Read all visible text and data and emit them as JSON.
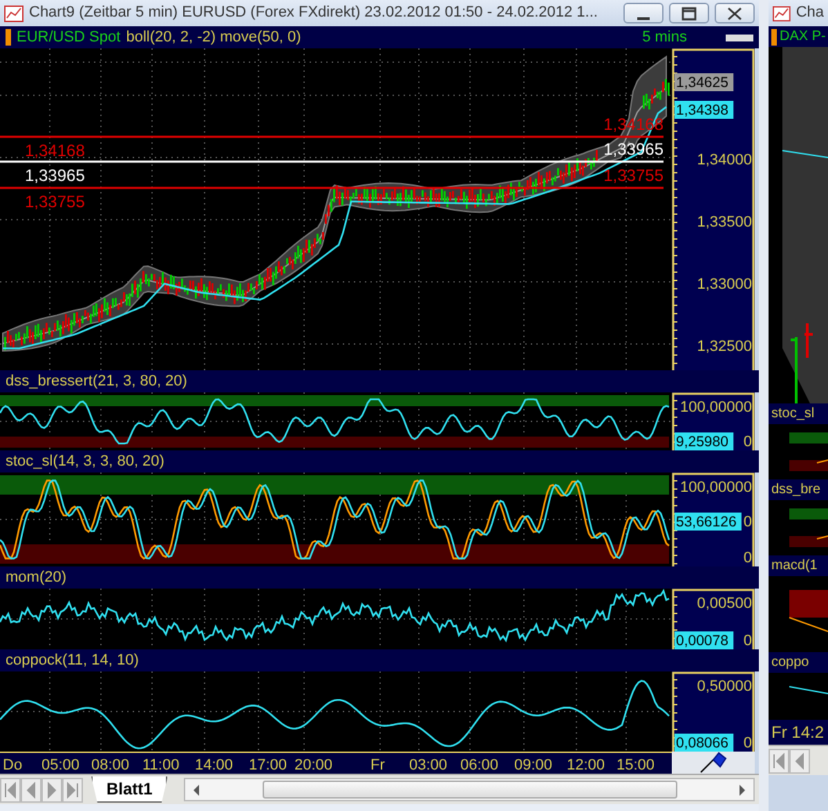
{
  "window": {
    "title": "Chart9 (Zeitbar 5 min)  EURUSD (Forex FXdirekt) 23.02.2012 01:50 - 24.02.2012 1..."
  },
  "chart_header": {
    "instrument": "EUR/USD Spot",
    "indicators": "boll(20, 2, -2) move(50, 0)",
    "interval": "5 mins"
  },
  "price_panel": {
    "axis_labels": [
      "1,34000",
      "1,33500",
      "1,33000",
      "1,32500"
    ],
    "last_price": "1,34625",
    "average": "1,34398",
    "levels": [
      {
        "left_label": "1,34168",
        "right_label": "1,34168",
        "color": "#e00000"
      },
      {
        "left_label": "1,33965",
        "right_label": "1,33965",
        "color": "#ffffff"
      },
      {
        "left_label": "1,33755",
        "right_label": "1,33755",
        "color": "#e00000"
      }
    ]
  },
  "panels": [
    {
      "title": "dss_bressert(21, 3, 80, 20)",
      "kind": "band",
      "top_label": "100,00000",
      "value": "9,25980",
      "zero_label": "0"
    },
    {
      "title": "stoc_sl(14, 3, 3, 80, 20)",
      "kind": "double_band",
      "top_label": "100,00000",
      "value": "53,66126",
      "zero_label": "0",
      "bottom_label": "0"
    },
    {
      "title": "mom(20)",
      "kind": "line",
      "top_label": "0,00500",
      "value": "0,00078",
      "zero_label": "0"
    },
    {
      "title": "coppock(11, 14, 10)",
      "kind": "smooth_line",
      "top_label": "0,50000",
      "value": "0,08066",
      "zero_label": "0"
    }
  ],
  "time_axis": [
    "Do",
    "05:00",
    "08:00",
    "11:00",
    "14:00",
    "17:00",
    "20:00",
    "Fr",
    "03:00",
    "06:00",
    "09:00",
    "12:00",
    "15:00"
  ],
  "sheet_tabs": [
    {
      "label": "Blatt1",
      "selected": true
    }
  ],
  "second_window": {
    "title": "Cha",
    "header": "DAX P-",
    "panels": [
      "stoc_sl",
      "dss_bre",
      "macd(1",
      "coppo"
    ],
    "time": "Fr 14:2"
  }
}
